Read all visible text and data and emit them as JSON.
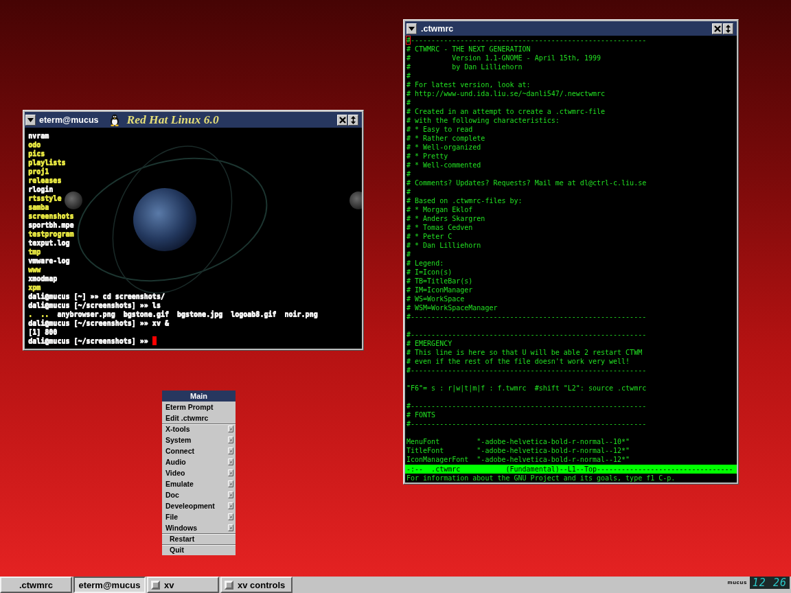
{
  "terminal_window": {
    "title": "eterm@mucus",
    "banner": "Red Hat Linux 6.0",
    "cursor": true,
    "lines": [
      {
        "kind": "line",
        "text": "nvram",
        "color": "#f0f0f0"
      },
      {
        "kind": "line",
        "text": "odo",
        "color": "#e0e040"
      },
      {
        "kind": "line",
        "text": "pics",
        "color": "#e0e040"
      },
      {
        "kind": "line",
        "text": "playlists",
        "color": "#e0e040"
      },
      {
        "kind": "line",
        "text": "proj1",
        "color": "#e0e040"
      },
      {
        "kind": "line",
        "text": "releases",
        "color": "#e0e040"
      },
      {
        "kind": "line",
        "text": "rlogin",
        "color": "#f0f0f0"
      },
      {
        "kind": "line",
        "text": "rtsstyle",
        "color": "#e0e040"
      },
      {
        "kind": "line",
        "text": "samba",
        "color": "#e0e040"
      },
      {
        "kind": "line",
        "text": "screenshots",
        "color": "#e0e040"
      },
      {
        "kind": "line",
        "text": "sportbh.mpe",
        "color": "#f0f0f0"
      },
      {
        "kind": "line",
        "text": "testprogram",
        "color": "#e0e040"
      },
      {
        "kind": "line",
        "text": "texput.log",
        "color": "#f0f0f0"
      },
      {
        "kind": "line",
        "text": "tmp",
        "color": "#e0e040"
      },
      {
        "kind": "line",
        "text": "vmware-log",
        "color": "#f0f0f0"
      },
      {
        "kind": "line",
        "text": "www",
        "color": "#e0e040"
      },
      {
        "kind": "line",
        "text": "xmodmap",
        "color": "#f0f0f0"
      },
      {
        "kind": "line",
        "text": "xpm",
        "color": "#e0e040"
      },
      {
        "kind": "line",
        "text": "dali@mucus [~] »» cd screenshots/",
        "color": "#f0f0f0"
      },
      {
        "kind": "line",
        "text": "dali@mucus [~/screenshots] »» ls",
        "color": "#f0f0f0"
      },
      {
        "kind": "listing",
        "entries": [
          {
            "text": ".",
            "color": "#e0e040"
          },
          {
            "text": "..",
            "color": "#e0e040"
          },
          {
            "text": "anybrowser.png",
            "color": "#f0f0f0"
          },
          {
            "text": "bgstone.gif",
            "color": "#f0f0f0"
          },
          {
            "text": "bgstone.jpg",
            "color": "#f0f0f0"
          },
          {
            "text": "logoab8.gif",
            "color": "#f0f0f0"
          },
          {
            "text": "noir.png",
            "color": "#f0f0f0"
          }
        ]
      },
      {
        "kind": "line",
        "text": "dali@mucus [~/screenshots] »» xv &",
        "color": "#f0f0f0"
      },
      {
        "kind": "line",
        "text": "[1] 800",
        "color": "#f0f0f0"
      },
      {
        "kind": "line",
        "text": "dali@mucus [~/screenshots] »»",
        "color": "#f0f0f0"
      }
    ]
  },
  "editor_window": {
    "title": ".ctwmrc",
    "cursor": true,
    "blocks": [
      [
        "#---------------------------------------------------------",
        "# CTWMRC - THE NEXT GENERATION",
        "#          Version 1.1-GNOME - April 15th, 1999",
        "#          by Dan Lilliehorn",
        "#",
        "# For latest version, look at:",
        "# http://www-und.ida.liu.se/~danli547/.newctwmrc",
        "#",
        "# Created in an attempt to create a .ctwmrc-file",
        "# with the following characteristics:",
        "# * Easy to read",
        "# * Rather complete",
        "# * Well-organized",
        "# * Pretty",
        "# * Well-commented",
        "#",
        "# Comments? Updates? Requests? Mail me at dl@ctrl-c.liu.se",
        "#",
        "# Based on .ctwmrc-files by:",
        "# * Morgan Eklof",
        "# * Anders Skargren",
        "# * Tomas Cedven",
        "# * Peter C",
        "# * Dan Lilliehorn",
        "#",
        "# Legend:",
        "# I=Icon(s)",
        "# TB=TitleBar(s)",
        "# IM=IconManager",
        "# WS=WorkSpace",
        "# WSM=WorkSpaceManager",
        "#---------------------------------------------------------"
      ],
      [
        "#---------------------------------------------------------",
        "# EMERGENCY",
        "# This line is here so that U will be able 2 restart CTWM",
        "# even if the rest of the file doesn't work very well!",
        "#---------------------------------------------------------"
      ],
      [
        "\"F6\"= s : r|w|t|m|f : f.twmrc  #shift \"L2\": source .ctwmrc"
      ],
      [
        "#---------------------------------------------------------",
        "# FONTS",
        "#---------------------------------------------------------"
      ],
      [
        "MenuFont         \"-adobe-helvetica-bold-r-normal--10*\"",
        "TitleFont        \"-adobe-helvetica-bold-r-normal--12*\"",
        "IconManagerFont  \"-adobe-helvetica-bold-r-normal--12*\""
      ]
    ],
    "mode_line": "-:--  .ctwmrc           (Fundamental)--L1--Top---------------------------------",
    "echo_area": "For information about the GNU Project and its goals, type f1 C-p."
  },
  "menu": {
    "title": "Main",
    "sections": [
      [
        {
          "label": "Eterm Prompt",
          "kind": "command"
        },
        {
          "label": "Edit .ctwmrc",
          "kind": "command"
        }
      ],
      [
        {
          "label": "X-tools",
          "kind": "submenu"
        },
        {
          "label": "System",
          "kind": "submenu"
        },
        {
          "label": "Connect",
          "kind": "submenu"
        },
        {
          "label": "Audio",
          "kind": "submenu"
        },
        {
          "label": "Video",
          "kind": "submenu"
        },
        {
          "label": "Emulate",
          "kind": "submenu"
        },
        {
          "label": "Doc",
          "kind": "submenu"
        },
        {
          "label": "Develeopment",
          "kind": "submenu"
        },
        {
          "label": "File",
          "kind": "submenu"
        },
        {
          "label": "Windows",
          "kind": "submenu"
        }
      ],
      [
        {
          "label": "Restart",
          "kind": "function"
        }
      ],
      [
        {
          "label": "Quit",
          "kind": "function"
        }
      ]
    ]
  },
  "taskbar": {
    "items": [
      {
        "label": ".ctwmrc",
        "selected": false,
        "iconified": false
      },
      {
        "label": "eterm@mucus",
        "selected": true,
        "iconified": false
      },
      {
        "label": "xv",
        "selected": false,
        "iconified": true
      },
      {
        "label": "xv controls",
        "selected": false,
        "iconified": true
      }
    ],
    "host": "mucus",
    "clock": "12 26"
  }
}
